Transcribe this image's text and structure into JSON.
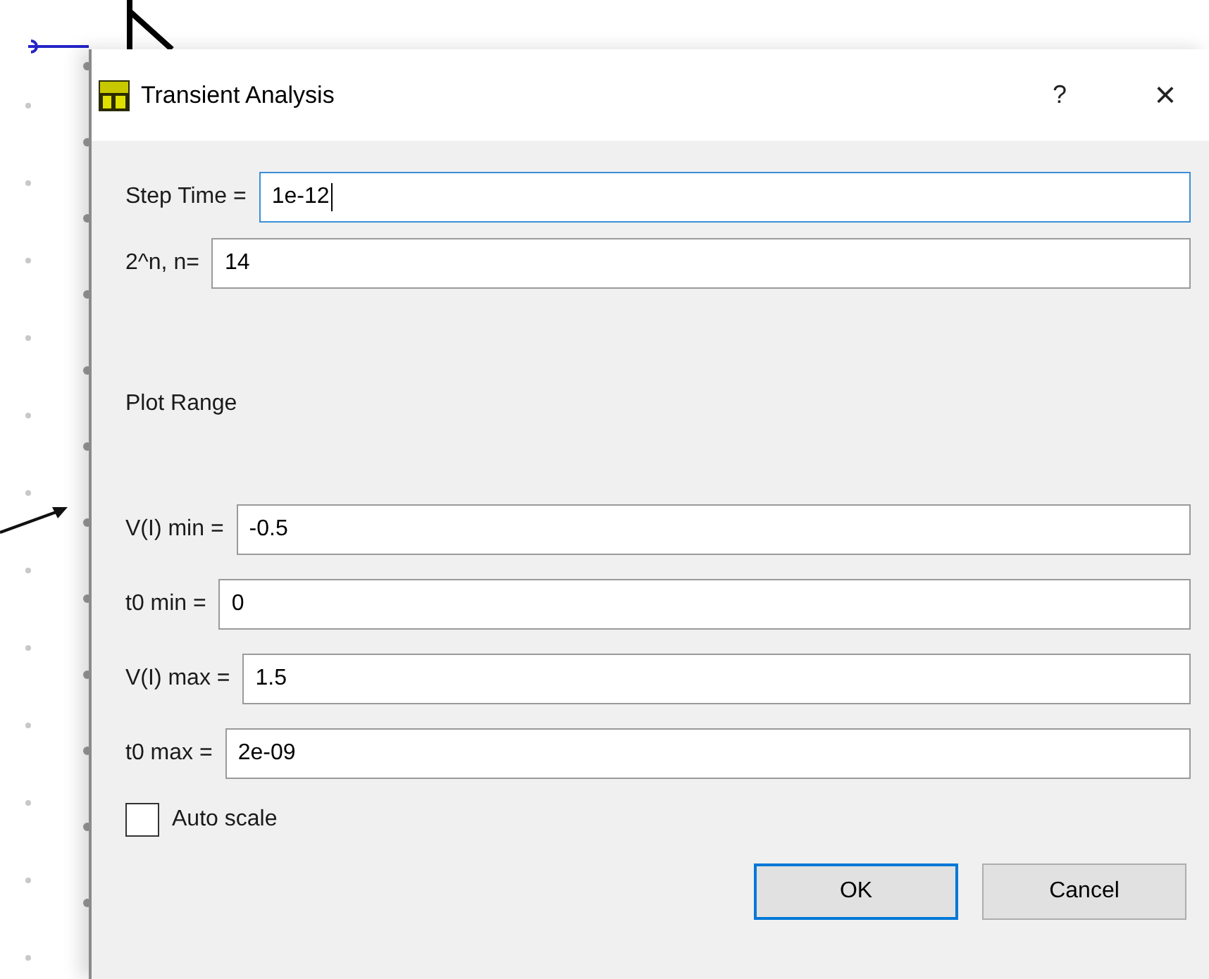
{
  "window": {
    "title": "Transient Analysis",
    "help": "?",
    "close": "×"
  },
  "fields": [
    {
      "label": "Step Time =",
      "value": "1e-12",
      "focused": true
    },
    {
      "label": "2^n, n=",
      "value": "14",
      "focused": false
    }
  ],
  "plot_range": {
    "title": "Plot Range",
    "fields": [
      {
        "label": "V(I) min =",
        "value": "-0.5",
        "focused": false
      },
      {
        "label": "t0 min =",
        "value": "0",
        "focused": false
      },
      {
        "label": "V(I) max =",
        "value": "1.5",
        "focused": false
      },
      {
        "label": "t0 max =",
        "value": "2e-09",
        "focused": false
      }
    ]
  },
  "auto_scale": {
    "label": "Auto scale",
    "checked": false
  },
  "buttons": [
    {
      "label": "OK",
      "default": true
    },
    {
      "label": "Cancel",
      "default": false
    }
  ]
}
